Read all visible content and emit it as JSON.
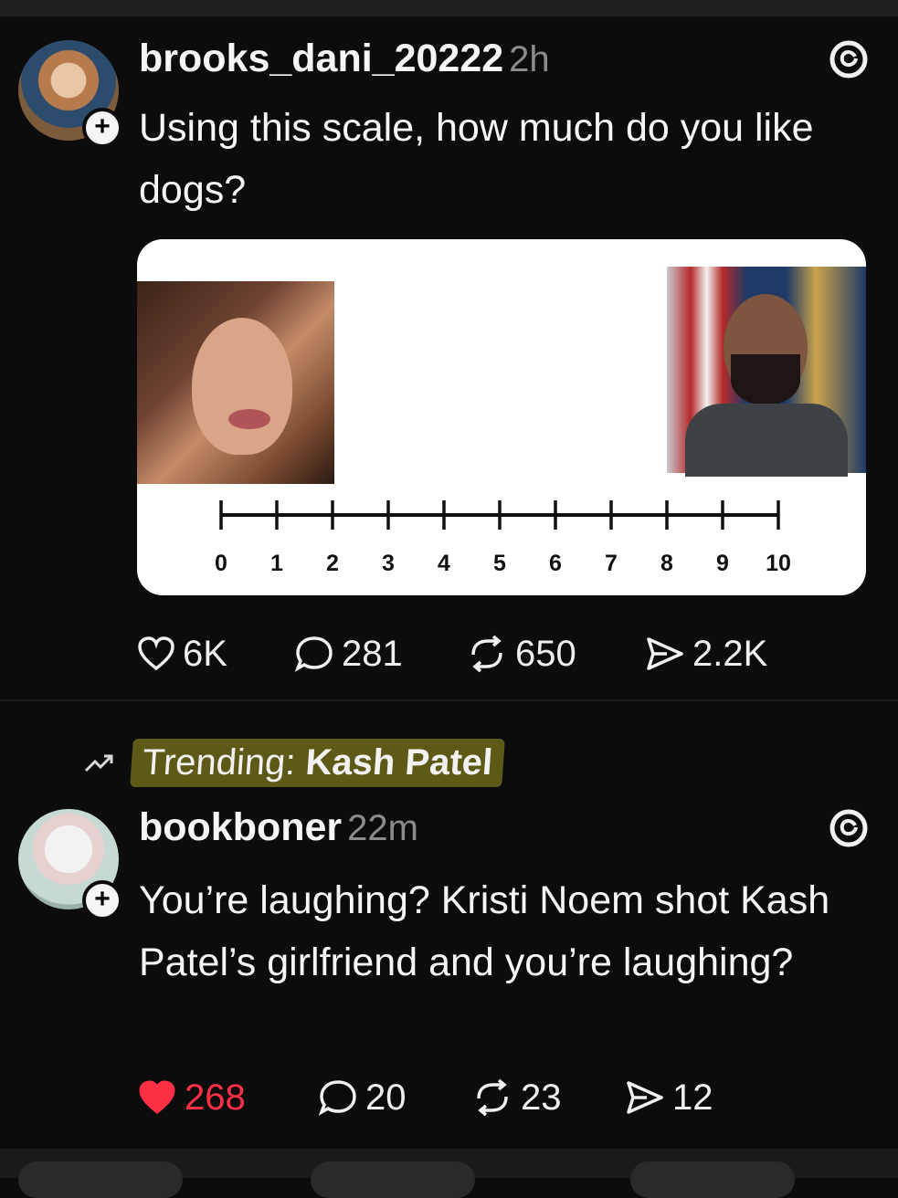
{
  "post1": {
    "username": "brooks_dani_20222",
    "time": "2h",
    "text": "Using this scale, how much do you like dogs?",
    "scale": {
      "labels": [
        "0",
        "1",
        "2",
        "3",
        "4",
        "5",
        "6",
        "7",
        "8",
        "9",
        "10"
      ]
    },
    "actions": {
      "likes": "6K",
      "replies": "281",
      "reposts": "650",
      "shares": "2.2K"
    }
  },
  "trending": {
    "prefix": "Trending:",
    "topic": "Kash Patel"
  },
  "post2": {
    "username": "bookboner",
    "time": "22m",
    "text": "You’re laughing? Kristi Noem shot Kash Patel’s girlfriend and you’re laughing?",
    "actions": {
      "likes": "268",
      "replies": "20",
      "reposts": "23",
      "shares": "12"
    },
    "liked": true
  },
  "colors": {
    "background": "#0c0c0c",
    "liked": "#ff3045",
    "trending_highlight": "#5d5a18",
    "muted": "#8c8c8c"
  },
  "icons": [
    "threads-logo-icon",
    "heart-icon",
    "comment-icon",
    "repost-icon",
    "share-icon",
    "trending-icon",
    "follow-plus-icon"
  ]
}
